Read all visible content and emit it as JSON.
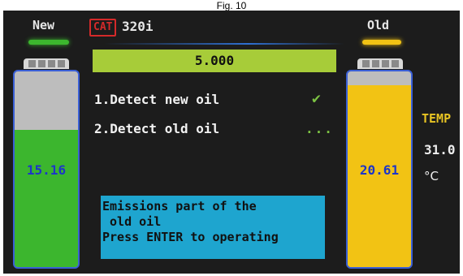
{
  "figure_caption": "Fig. 10",
  "header": {
    "new_label": "New",
    "brand": "CAT",
    "model": "320i",
    "old_label": "Old"
  },
  "progress": {
    "value": "5.000"
  },
  "steps": [
    {
      "label": "1.Detect new oil",
      "status_icon": "check-icon",
      "status": "done"
    },
    {
      "label": "2.Detect old oil",
      "status_icon": "...",
      "status": "in-progress"
    }
  ],
  "new_tank": {
    "value": "15.16",
    "fill_fraction": 0.7,
    "color": "#3cb62e"
  },
  "old_tank": {
    "value": "20.61",
    "fill_fraction": 0.93,
    "color": "#f2c314"
  },
  "message": {
    "lines": [
      "Emissions part of the",
      " old oil",
      "Press ENTER to operating"
    ]
  },
  "temperature": {
    "label": "TEMP",
    "value": "31.0",
    "unit": "°C"
  },
  "colors": {
    "screen_bg": "#1c1c1c",
    "progress_bar": "#a7cc39",
    "message_bg": "#1ea5cf",
    "temp_label": "#e8c423",
    "new_glow": "#3cb62e",
    "old_glow": "#f2c314"
  }
}
